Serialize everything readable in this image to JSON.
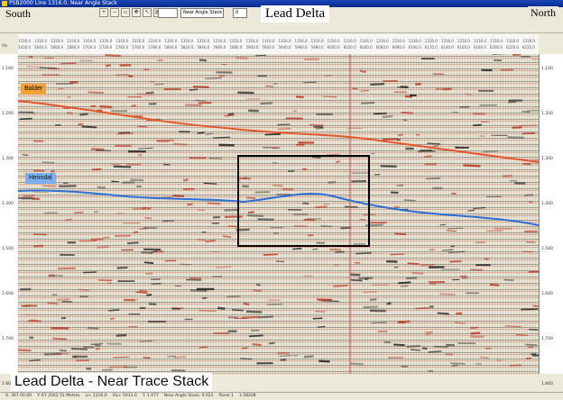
{
  "window": {
    "title": "PSB2000 Line 1316.0, Near Angle Stack"
  },
  "toolbar": {
    "zoom_value": "",
    "stack_select": "Near Angle Stack",
    "page_field": "0"
  },
  "labels": {
    "south": "South",
    "north": "North",
    "title": "Lead Delta",
    "caption": "Lead Delta - Near Trace Stack"
  },
  "horizons": {
    "balder": "Balder",
    "heimdal": "Heimdal",
    "balder_color": "#e4572e",
    "heimdal_color": "#2f6fd6"
  },
  "header": {
    "row1_label": "Ln",
    "row2_label": "Xln",
    "inline_values": [
      "1316.0",
      "1316.0",
      "1316.0",
      "1316.0",
      "1316.0",
      "1316.0",
      "1316.0",
      "1316.0",
      "1316.0",
      "1316.0",
      "1316.0",
      "1316.0",
      "1316.0",
      "1316.0",
      "1316.0",
      "1316.0",
      "1316.0",
      "1316.0",
      "1316.0",
      "1316.0",
      "1316.0",
      "1316.0",
      "1316.0",
      "1316.0",
      "1316.0",
      "1316.0",
      "1316.0",
      "1316.0",
      "1316.0",
      "1316.0",
      "1316.0",
      "1316.0"
    ],
    "xline_values": [
      "5620.0",
      "5640.0",
      "5660.0",
      "5680.0",
      "5700.0",
      "5720.0",
      "5740.0",
      "5760.0",
      "5780.0",
      "5800.0",
      "5820.0",
      "5840.0",
      "5860.0",
      "5880.0",
      "5900.0",
      "5920.0",
      "5940.0",
      "5960.0",
      "5980.0",
      "6000.0",
      "6020.0",
      "6040.0",
      "6060.0",
      "6080.0",
      "6100.0",
      "6120.0",
      "6140.0",
      "6160.0",
      "6180.0",
      "6200.0",
      "6220.0",
      "6235.0"
    ]
  },
  "time_ticks": [
    "1.100",
    "1.200",
    "1.300",
    "1.400",
    "1.500",
    "1.600",
    "1.700",
    "1.800"
  ],
  "statusbar": {
    "items": [
      "X: 397 00.00",
      "Y: 67 2562 51 Metres",
      "Ln: 1316.0",
      "XLn: 5913.0",
      "T: 1.077",
      "Near Angle Stack: 0.022",
      "Panel 1",
      "1:58208"
    ]
  }
}
